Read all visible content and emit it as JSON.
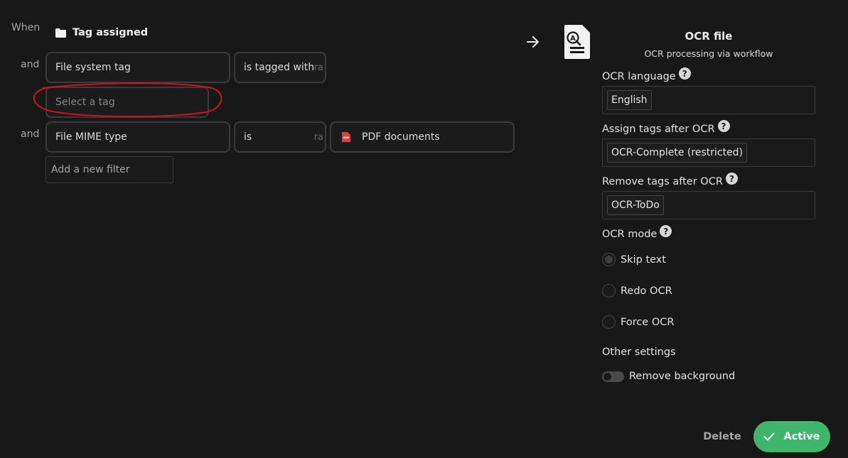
{
  "trigger": {
    "when_label": "When",
    "event": "Tag assigned",
    "event_icon": "folder-icon"
  },
  "filters": [
    {
      "connector": "and",
      "field": "File system tag",
      "operator": "is tagged with",
      "operator_suffix": "ra",
      "value_placeholder": "Select a tag"
    },
    {
      "connector": "and",
      "field": "File MIME type",
      "operator": "is",
      "operator_suffix": "ra",
      "value": "PDF documents",
      "value_icon": "pdf-icon"
    }
  ],
  "add_filter_placeholder": "Add a new filter",
  "action": {
    "arrow_icon": "arrow-right-icon",
    "icon": "ocr-document-icon",
    "title": "OCR file",
    "subtitle": "OCR processing via workflow",
    "language_label": "OCR language",
    "language_value": "English",
    "assign_tags_label": "Assign tags after OCR",
    "assign_tags_value": "OCR-Complete (restricted)",
    "remove_tags_label": "Remove tags after OCR",
    "remove_tags_value": "OCR-ToDo",
    "mode_label": "OCR mode",
    "modes": [
      {
        "label": "Skip text",
        "selected": true
      },
      {
        "label": "Redo OCR",
        "selected": false
      },
      {
        "label": "Force OCR",
        "selected": false
      }
    ],
    "other_settings_label": "Other settings",
    "remove_background_label": "Remove background",
    "remove_background_on": false,
    "help_symbol": "?"
  },
  "footer": {
    "delete_label": "Delete",
    "active_label": "Active",
    "active_color": "#3fb66a"
  },
  "annotation_color": "#d11414"
}
